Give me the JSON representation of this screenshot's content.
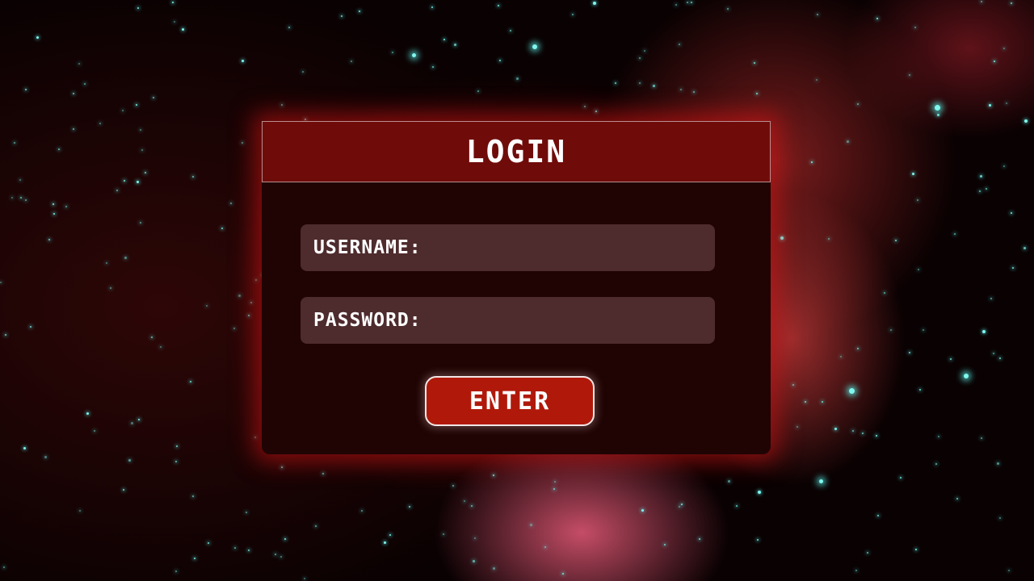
{
  "login_panel": {
    "title": "LOGIN",
    "username_label": "USERNAME:",
    "password_label": "PASSWORD:",
    "username_value": "",
    "password_value": "",
    "enter_label": "ENTER"
  },
  "colors": {
    "header_bg": "#6f0c0a",
    "panel_bg": "#1f0403",
    "field_bg": "#4e2b2d",
    "button_bg": "#b0190a",
    "star": "#7ff7ee"
  },
  "background": {
    "description_icon": "nebula-starfield-background"
  }
}
